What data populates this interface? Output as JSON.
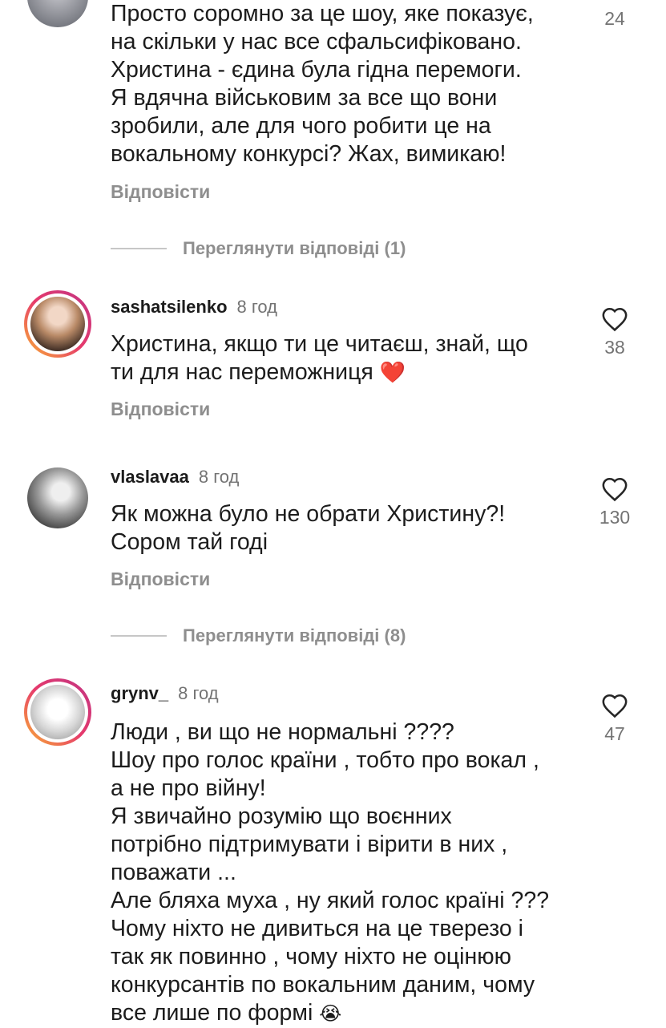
{
  "comments": [
    {
      "username": "",
      "time": "",
      "text": "Просто соромно за це шоу, яке показує,\nна скільки у нас все сфальсифіковано.\nХристина - єдина була гідна перемоги.\nЯ вдячна військовим за все що вони\nзробили, але для чого робити це на\nвокальному конкурсі? Жах, вимикаю!",
      "likes": "24",
      "reply_label": "Відповісти"
    },
    {
      "username": "sashatsilenko",
      "time": "8 год",
      "text": "Христина, якщо ти це читаєш, знай, що\nти для нас переможниця",
      "emoji": "❤️",
      "likes": "38",
      "reply_label": "Відповісти"
    },
    {
      "username": "vlaslavaa",
      "time": "8 год",
      "text": "Як можна було не обрати Христину?!\nСором тай годі",
      "likes": "130",
      "reply_label": "Відповісти"
    },
    {
      "username": "grynv_",
      "time": "8 год",
      "text": "Люди , ви що не нормальні ????\nШоу про голос країни , тобто про вокал ,\nа не про війну!\nЯ звичайно розумію що воєнних\nпотрібно підтримувати і вірити в них ,\nповажати ...\nАле бляха муха , ну який голос країні ???\nЧому ніхто не дивиться на це тверезо і\nтак як повинно , чому ніхто не оцінюю\nконкурсантів по вокальним даним, чому\nвсе лише по формі",
      "emoji": "😭",
      "likes": "47"
    }
  ],
  "view_replies": [
    {
      "label": "Переглянути відповіді (1)"
    },
    {
      "label": "Переглянути відповіді (8)"
    }
  ],
  "icons": {
    "like": "heart-outline-icon",
    "like_color": "#262626"
  }
}
